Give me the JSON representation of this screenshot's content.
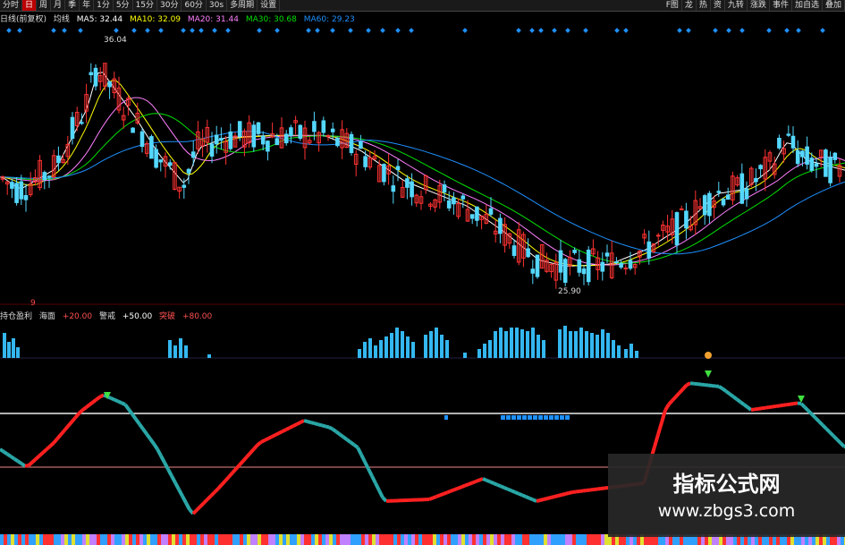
{
  "toolbar": {
    "items": [
      "分时",
      "日",
      "周",
      "月",
      "季",
      "年",
      "1分",
      "5分",
      "15分",
      "30分",
      "60分",
      "30s",
      "多周期",
      "设置"
    ],
    "active_index": 1,
    "right_items": [
      "F图",
      "龙",
      "热",
      "资",
      "九转",
      "涨跌",
      "事件",
      "加自选",
      "叠加"
    ]
  },
  "legend": {
    "main_label": "日线(前复权)",
    "indicator_label": "均线",
    "ma5": "MA5: 32.44",
    "ma10": "MA10: 32.09",
    "ma20": "MA20: 31.44",
    "ma30": "MA30: 30.68",
    "ma60": "MA60: 29.23"
  },
  "colors": {
    "up": "#ff3232",
    "down": "#54d8ff",
    "ma5": "#ffffff",
    "ma10": "#ffff00",
    "ma20": "#ff80ff",
    "ma30": "#00e000",
    "ma60": "#1e90ff",
    "hist": "#34b7f0",
    "marker": "#1e90ff",
    "osc_up": "#ff2020",
    "osc_down": "#2aa7a7"
  },
  "indicator_legend": {
    "title": "持仓盈利",
    "t1": "海面",
    "v1": "+20.00",
    "t2": "警戒",
    "v2": "+50.00",
    "t3": "突破",
    "v3": "+80.00",
    "side_label": "9"
  },
  "chart_data": {
    "type": "candlestick",
    "high_annotation": "36.04",
    "low_annotation": "25.90",
    "ma_series": [
      "MA5",
      "MA10",
      "MA20",
      "MA30",
      "MA60"
    ],
    "indicator_reference_lines": [
      80,
      20
    ]
  },
  "watermark": {
    "line1": "指标公式网",
    "line2": "www.zbgs3.com"
  }
}
